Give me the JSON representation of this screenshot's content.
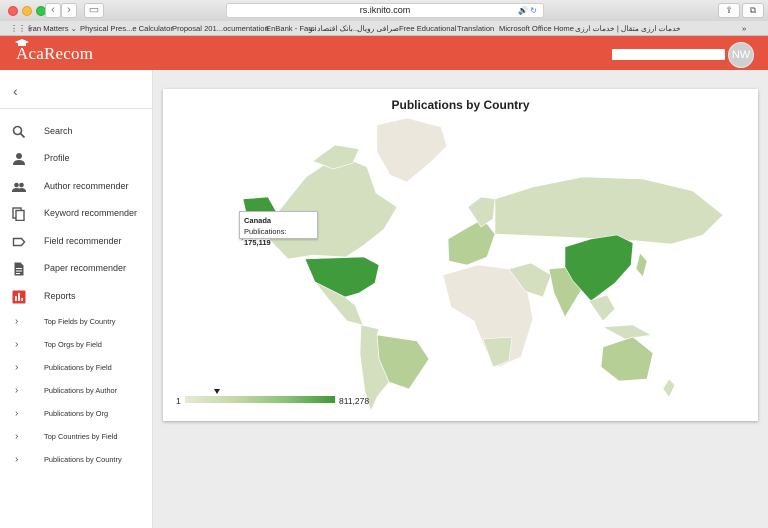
{
  "browser": {
    "url": "rs.iknito.com",
    "bookmarks": [
      "Iran Matters ⌄",
      "Physical Pres...e Calculator",
      "Proposal 201...ocumentation",
      "EnBank - Farsi",
      "بانک اقتصاد نو...",
      "صرافی رویال",
      "Free Educational",
      "Translation",
      "Microsoft Office Home",
      "خدمات ارزی متقال | خدمات ارزی"
    ]
  },
  "app": {
    "logo": "AcaRecom",
    "search_value": "",
    "avatar_initials": "NW"
  },
  "sidebar": {
    "items": [
      {
        "label": "Search",
        "icon": "search-icon"
      },
      {
        "label": "Profile",
        "icon": "person-icon"
      },
      {
        "label": "Author recommender",
        "icon": "people-icon"
      },
      {
        "label": "Keyword recommender",
        "icon": "copy-icon"
      },
      {
        "label": "Field recommender",
        "icon": "label-icon"
      },
      {
        "label": "Paper recommender",
        "icon": "document-icon"
      },
      {
        "label": "Reports",
        "icon": "bar-chart-icon"
      }
    ],
    "reports": [
      "Top Fields by Country",
      "Top Orgs by Field",
      "Publications by Field",
      "Publications by Author",
      "Publications by Org",
      "Top Countries by Field",
      "Publications by Country"
    ]
  },
  "map": {
    "title": "Publications by Country",
    "tooltip_country": "Canada",
    "tooltip_label": "Publications:",
    "tooltip_value": "175,119",
    "legend_min": "1",
    "legend_max": "811,278",
    "colors": {
      "highest": "#3f9b3b",
      "high": "#57a94b",
      "medium": "#b6cf97",
      "low": "#d4dfbf",
      "lowest": "#ebe7dc",
      "no_data": "#f0ece2",
      "water": "#ffffff"
    }
  }
}
